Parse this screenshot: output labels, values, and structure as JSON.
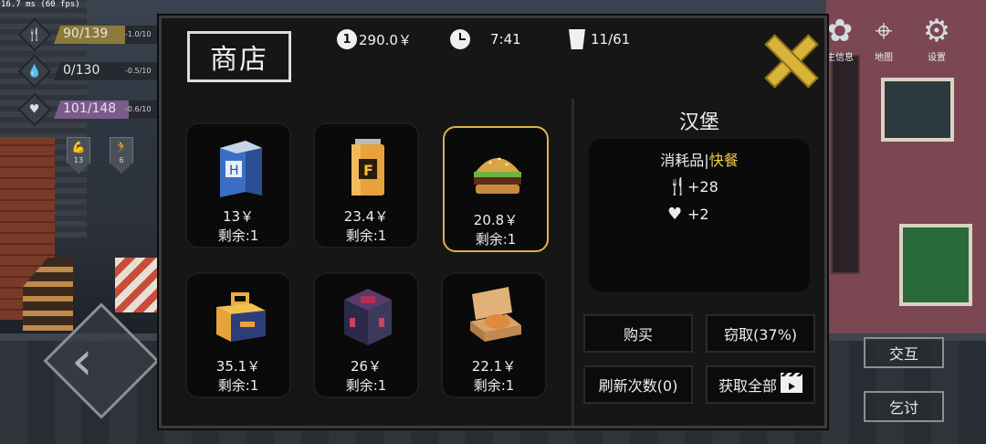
{
  "fps": "16.7 ms (60 fps)",
  "stats": [
    {
      "icon": "fork-knife-icon",
      "glyph": "🍴",
      "value": "90/139",
      "rate": "-1.0/10",
      "fill": 0.65,
      "color": "#8c7a3a"
    },
    {
      "icon": "water-drop-icon",
      "glyph": "💧",
      "value": "0/130",
      "rate": "-0.5/10",
      "fill": 0.0,
      "color": "#3d4a66"
    },
    {
      "icon": "heart-icon",
      "glyph": "♥",
      "value": "101/148",
      "rate": "-0.6/10",
      "fill": 0.68,
      "color": "#7c5a8c"
    }
  ],
  "skills": [
    {
      "icon": "arm-icon",
      "glyph": "💪",
      "value": "13"
    },
    {
      "icon": "running-icon",
      "glyph": "🏃",
      "value": "6"
    }
  ],
  "top_right": {
    "info_label": "生信息",
    "map_label": "地图",
    "settings_label": "设置"
  },
  "side_buttons": {
    "interact": "交互",
    "beg": "乞讨"
  },
  "shop": {
    "title": "商店",
    "coin_symbol": "1",
    "money": "290.0￥",
    "time": "7:41",
    "bin": "11/61",
    "items": [
      {
        "name": "milk-carton",
        "price": "13￥",
        "stock": "剩余:1"
      },
      {
        "name": "energy-can",
        "price": "23.4￥",
        "stock": "剩余:1"
      },
      {
        "name": "burger",
        "price": "20.8￥",
        "stock": "剩余:1",
        "selected": true
      },
      {
        "name": "lunchbox",
        "price": "35.1￥",
        "stock": "剩余:1"
      },
      {
        "name": "crate",
        "price": "26￥",
        "stock": "剩余:1"
      },
      {
        "name": "pizza-box",
        "price": "22.1￥",
        "stock": "剩余:1"
      }
    ],
    "detail": {
      "title": "汉堡",
      "category": "消耗品",
      "separator": "|",
      "subcategory": "快餐",
      "effects": [
        {
          "icon": "fork-knife-icon",
          "glyph": "🍴",
          "text": "+28"
        },
        {
          "icon": "heart-pulse-icon",
          "glyph": "♥",
          "text": "+2"
        }
      ]
    },
    "buttons": {
      "buy": "购买",
      "steal": "窃取(37%)",
      "refresh": "刷新次数(0)",
      "get_all": "获取全部"
    }
  }
}
